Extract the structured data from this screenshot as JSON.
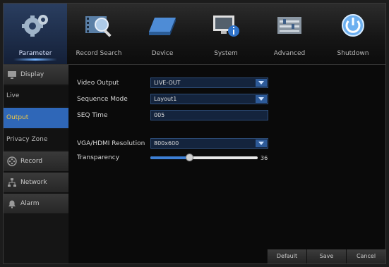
{
  "top_menu": [
    {
      "label": "Parameter",
      "icon": "gears-icon",
      "active": true
    },
    {
      "label": "Record Search",
      "icon": "film-search-icon"
    },
    {
      "label": "Device",
      "icon": "hard-drive-icon"
    },
    {
      "label": "System",
      "icon": "monitor-info-icon"
    },
    {
      "label": "Advanced",
      "icon": "sliders-icon"
    },
    {
      "label": "Shutdown",
      "icon": "power-icon"
    }
  ],
  "sidebar": {
    "display": "Display",
    "live": "Live",
    "output": "Output",
    "privacy_zone": "Privacy Zone",
    "record": "Record",
    "network": "Network",
    "alarm": "Alarm"
  },
  "form": {
    "video_output": {
      "label": "Video Output",
      "value": "LIVE-OUT"
    },
    "sequence_mode": {
      "label": "Sequence Mode",
      "value": "Layout1"
    },
    "seq_time": {
      "label": "SEQ Time",
      "value": "005"
    },
    "resolution": {
      "label": "VGA/HDMI Resolution",
      "value": "800x600"
    },
    "transparency": {
      "label": "Transparency",
      "value": "36",
      "fraction": 0.36
    }
  },
  "buttons": {
    "default": "Default",
    "save": "Save",
    "cancel": "Cancel"
  },
  "colors": {
    "accent": "#2f67b8",
    "active_text": "#f1c844"
  }
}
